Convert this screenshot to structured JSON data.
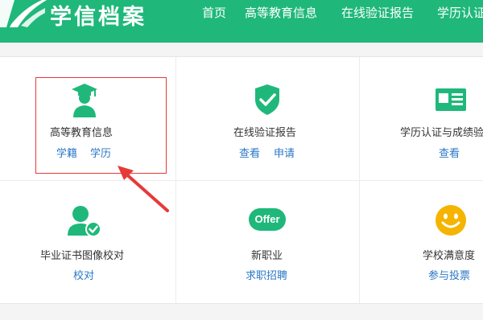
{
  "header": {
    "logo_text": "学信档案",
    "nav": [
      "首页",
      "高等教育信息",
      "在线验证报告",
      "学历认证"
    ]
  },
  "tiles": [
    {
      "title": "高等教育信息",
      "links": [
        "学籍",
        "学历"
      ],
      "icon": "graduate-icon"
    },
    {
      "title": "在线验证报告",
      "links": [
        "查看",
        "申请"
      ],
      "icon": "shield-check-icon"
    },
    {
      "title": "学历认证与成绩验",
      "links": [
        "查看"
      ],
      "icon": "id-card-icon"
    },
    {
      "title": "毕业证书图像校对",
      "links": [
        "校对"
      ],
      "icon": "user-check-icon"
    },
    {
      "title": "新职业",
      "links": [
        "求职招聘"
      ],
      "icon": "offer-icon",
      "icon_label": "Offer"
    },
    {
      "title": "学校满意度",
      "links": [
        "参与投票"
      ],
      "icon": "smiley-icon"
    }
  ],
  "colors": {
    "brand": "#1fb87a",
    "link": "#2a77c6",
    "highlight": "#e63a3a",
    "smiley": "#f5b400"
  }
}
